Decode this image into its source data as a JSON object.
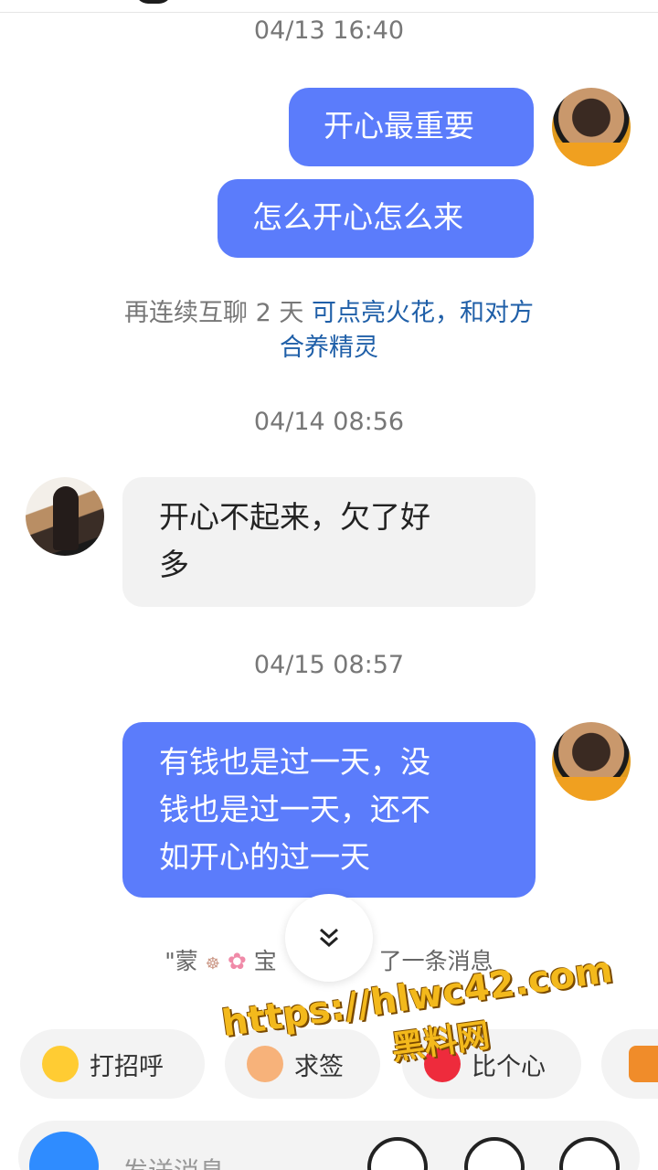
{
  "timestamps": [
    "04/13 16:40",
    "04/14 08:56",
    "04/15 08:57"
  ],
  "messages": [
    {
      "side": "sent",
      "text": "开心最重要"
    },
    {
      "side": "sent",
      "text": "怎么开心怎么来"
    },
    {
      "side": "received",
      "lines": [
        "开心不起来，欠了好",
        "多"
      ]
    },
    {
      "side": "sent",
      "lines": [
        "有钱也是过一天，没",
        "钱也是过一天，还不",
        "如开心的过一天"
      ]
    }
  ],
  "streak": {
    "prefix": "再连续互聊 2 天",
    "link_line1": "可点亮火花，和对方",
    "link_line2": "合养精灵"
  },
  "recall_notice": {
    "name_part1": "\"蒙",
    "name_part2": "宝",
    "suffix": "了一条消息"
  },
  "quick_actions": [
    {
      "icon": "smile-emoji-icon",
      "label": "打招呼"
    },
    {
      "icon": "flower-icon",
      "label": "求签"
    },
    {
      "icon": "heart-icon",
      "label": "比个心"
    },
    {
      "icon": "people-icon",
      "label": ""
    }
  ],
  "watermark": {
    "url": "https://hlwc42.com",
    "cn": "黑料网"
  },
  "composer": {
    "placeholder": "发送消息"
  },
  "colors": {
    "sent_bubble": "#5b7cfb",
    "received_bubble": "#f2f2f2",
    "link": "#1f5fa8",
    "camera": "#2f8cff"
  }
}
